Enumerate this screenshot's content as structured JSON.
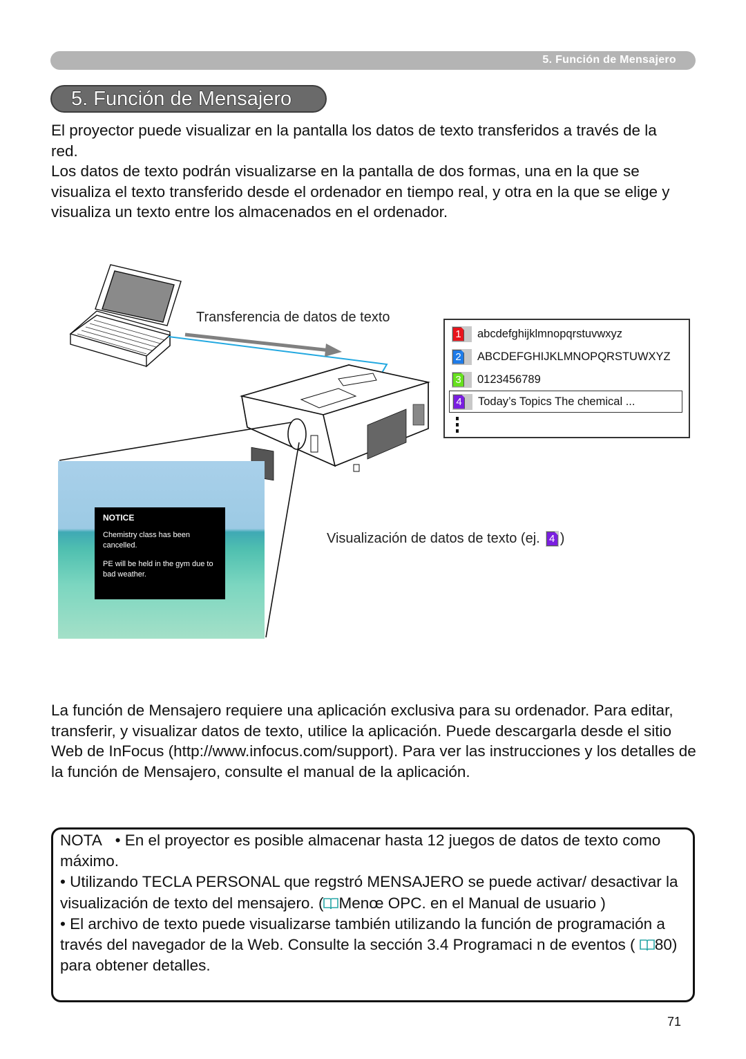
{
  "header": {
    "section_label": "5. Función de Mensajero"
  },
  "title": "5. Función de Mensajero",
  "intro": {
    "line1": "El proyector puede visualizar en la pantalla los datos de texto transferidos a través de la red.",
    "line2": "Los datos de texto podrán visualizarse en la pantalla de dos formas, una en la que se visualiza el texto transferido desde el ordenador en tiempo real, y otra en la que se elige y visualiza un texto entre los almacenados en el ordenador."
  },
  "diagram": {
    "transfer_label": "Transferencia de datos de texto",
    "display_label_prefix": "Visualización de datos de texto (ej.",
    "display_label_badge": "4",
    "display_label_suffix": ")",
    "list": [
      {
        "num": "1",
        "text": "abcdefghijklmnopqrstuvwxyz",
        "color": "#e8141c"
      },
      {
        "num": "2",
        "text": "ABCDEFGHIJKLMNOPQRSTUWXYZ",
        "color": "#1e7be8"
      },
      {
        "num": "3",
        "text": "0123456789",
        "color": "#66e01e"
      },
      {
        "num": "4",
        "text": "Today’s Topics The chemical ...",
        "color": "#7a1ee0",
        "selected": true
      }
    ],
    "notice": {
      "title": "NOTICE",
      "line1": "Chemistry class has been cancelled.",
      "line2": "PE will be held in the gym due to bad weather."
    },
    "cable_color": "#22a8e0"
  },
  "body": "La función de Mensajero requiere una aplicación exclusiva para su ordenador. Para editar, transferir, y visualizar datos de texto, utilice la aplicación. Puede descargarla desde el sitio Web de InFocus (http://www.infocus.com/support). Para ver las instrucciones y los detalles de la función de Mensajero, consulte el manual de la aplicación.",
  "note": {
    "label": "NOTA",
    "item1": "• En el proyector es posible almacenar hasta 12 juegos de datos de texto como máximo.",
    "item2_a": "• Utilizando TECLA PERSONAL que regstró MENSAJERO se puede activar/ desactivar la visualización de texto del mensajero. (",
    "item2_b": "Menœ OPC. en el Manual de usuario  )",
    "item3_a": "• El archivo de texto puede visualizarse también utilizando la función de programación a través del navegador de la Web. Consulte la sección 3.4 Programaci n de eventos (   ",
    "item3_b": "80) para obtener detalles."
  },
  "page_number": "71"
}
